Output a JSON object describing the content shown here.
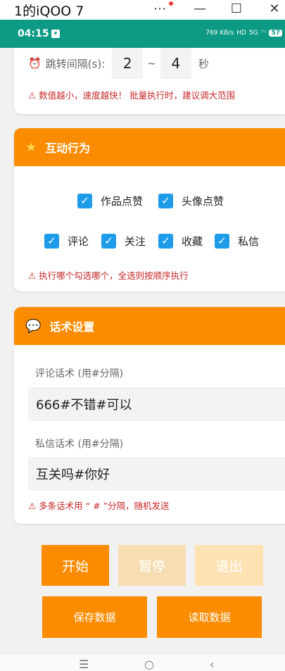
{
  "window": {
    "title": "1的iQOO 7",
    "more_icon": "more-horizontal-icon",
    "min": "—",
    "max": "☐",
    "close": "✕"
  },
  "status": {
    "time": "04:15",
    "net_speed": "769 KB/s",
    "hd": "HD",
    "signal": "5G",
    "battery": "57"
  },
  "card_jump": {
    "label": "跳转间隔(s):",
    "min_value": "2",
    "separator": "~",
    "max_value": "4",
    "unit": "秒",
    "warning": "⚠ 数值越小，速度越快！ 批量执行时，建议调大范围"
  },
  "card_interact": {
    "title": "互动行为",
    "row1": [
      "作品点赞",
      "头像点赞"
    ],
    "row2": [
      "评论",
      "关注",
      "收藏",
      "私信"
    ],
    "warning": "⚠ 执行哪个勾选哪个，全选则按顺序执行"
  },
  "card_script": {
    "title": "话术设置",
    "comment_label": "评论话术 (用#分隔)",
    "comment_value": "666#不错#可以",
    "dm_label": "私信话术 (用#分隔)",
    "dm_value": "互关吗#你好",
    "warning": "⚠ 多条话术用 “ # ”分隔，随机发送"
  },
  "buttons": {
    "start": "开始",
    "pause": "暂停",
    "exit": "退出",
    "save": "保存数据",
    "load": "读取数据"
  },
  "colors": {
    "accent": "#fb8c00",
    "statusbar": "#0c9a85",
    "checkbox": "#1e9be9",
    "warning": "#c62828"
  }
}
